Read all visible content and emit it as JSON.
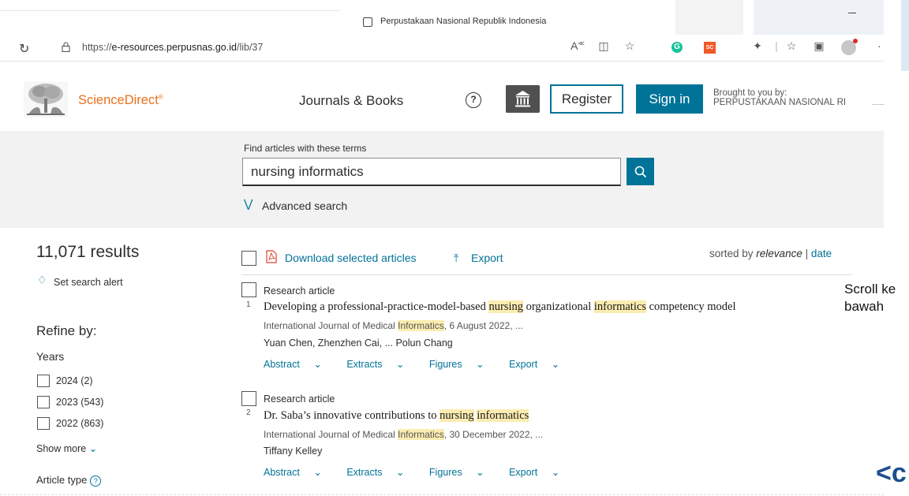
{
  "browser": {
    "window_title": "Perpustakaan Nasional Republik Indonesia",
    "url_prefix": "https://",
    "url_host": "e-resources.perpusnas.go.id",
    "url_path": "/lib/37",
    "toolbar_icons": [
      "reload-icon",
      "lock-icon",
      "read-aloud-icon",
      "split-screen-icon",
      "favorite-icon",
      "grammarly-icon",
      "sc-extension-icon",
      "extensions-icon",
      "favorites-bar-icon",
      "collections-icon",
      "profile-avatar",
      "more-icon"
    ],
    "grammarly_letter": "G",
    "sc_label": "SC"
  },
  "header": {
    "brand": "ScienceDirect",
    "brand_mark": "®",
    "journals_books": "Journals & Books",
    "help_symbol": "?",
    "register": "Register",
    "sign_in": "Sign in",
    "brought_line1": "Brought to you by:",
    "brought_line2": "PERPUSTAKAAN NASIONAL RI"
  },
  "search": {
    "label": "Find articles with these terms",
    "value": "nursing informatics",
    "advanced": "Advanced search",
    "advanced_icon": "⪧"
  },
  "sidebar": {
    "results": "11,071 results",
    "set_alert": "Set search alert",
    "refine": "Refine by:",
    "years_label": "Years",
    "years": [
      {
        "label": "2024 (2)"
      },
      {
        "label": "2023 (543)"
      },
      {
        "label": "2022 (863)"
      }
    ],
    "show_more": "Show more",
    "article_type": "Article type"
  },
  "results_header": {
    "download": "Download selected articles",
    "export": "Export",
    "sorted_by": "sorted by",
    "relevance": "relevance",
    "separator": "|",
    "date": "date"
  },
  "results": [
    {
      "type": "Research article",
      "number": "1",
      "title_parts": [
        {
          "t": "Developing a professional-practice-model-based ",
          "hl": false
        },
        {
          "t": "nursing",
          "hl": true
        },
        {
          "t": " organizational ",
          "hl": false
        },
        {
          "t": "informatics",
          "hl": true
        },
        {
          "t": " competency model",
          "hl": false
        }
      ],
      "source_parts": [
        {
          "t": "International Journal of Medical ",
          "hl": false
        },
        {
          "t": "Informatics",
          "hl": true
        },
        {
          "t": ", 6 August 2022, ...",
          "hl": false
        }
      ],
      "authors": "Yuan Chen, Zhenzhen Cai, ... Polun Chang",
      "links": [
        "Abstract",
        "Extracts",
        "Figures",
        "Export"
      ]
    },
    {
      "type": "Research article",
      "number": "2",
      "title_parts": [
        {
          "t": "Dr. Saba’s innovative contributions to ",
          "hl": false
        },
        {
          "t": "nursing",
          "hl": true
        },
        {
          "t": " ",
          "hl": false
        },
        {
          "t": "informatics",
          "hl": true
        }
      ],
      "source_parts": [
        {
          "t": "International Journal of Medical ",
          "hl": false
        },
        {
          "t": "Informatics",
          "hl": true
        },
        {
          "t": ", 30 December 2022, ...",
          "hl": false
        }
      ],
      "authors": "Tiffany Kelley",
      "links": [
        "Abstract",
        "Extracts",
        "Figures",
        "Export"
      ]
    }
  ],
  "overlay": {
    "scroll_line1": "Scroll ke",
    "scroll_line2": "bawah",
    "corner_logo": "<c"
  },
  "colors": {
    "accent": "#007398",
    "brand_orange": "#e9711c",
    "highlight": "#fbecb0"
  }
}
